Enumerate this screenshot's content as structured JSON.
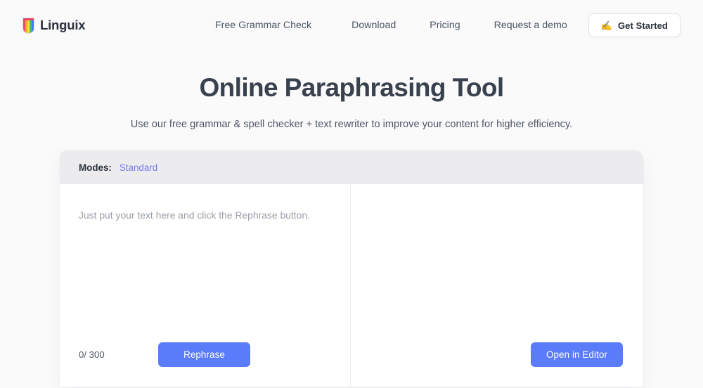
{
  "brand": {
    "name": "Linguix",
    "logo_icon": "rainbow-bookmark-icon"
  },
  "nav": {
    "links": [
      {
        "label": "Free Grammar Check"
      },
      {
        "label": "Download"
      },
      {
        "label": "Pricing"
      },
      {
        "label": "Request a demo"
      }
    ],
    "cta": {
      "label": "Get Started",
      "icon": "writing-hand-emoji",
      "glyph": "✍️"
    }
  },
  "hero": {
    "title": "Online Paraphrasing Tool",
    "subtitle": "Use our free grammar & spell checker + text rewriter to improve your content for higher efficiency."
  },
  "tool": {
    "modes": {
      "label": "Modes:",
      "selected": "Standard",
      "options": [
        "Standard"
      ]
    },
    "input": {
      "placeholder": "Just put your text here and click the Rephrase button.",
      "value": "",
      "char_count": "0/ 300",
      "max_chars": 300
    },
    "rephrase_button": "Rephrase",
    "output": {
      "value": "",
      "open_editor_button": "Open in Editor"
    }
  },
  "colors": {
    "page_background": "#fafafb",
    "card_background": "#ffffff",
    "modes_bar": "#ececee",
    "accent_blue": "#5b7cfa",
    "mode_purple": "#7b78e5",
    "heading": "#39414e",
    "body_text": "#4b5563",
    "placeholder": "#9aa0a8"
  }
}
